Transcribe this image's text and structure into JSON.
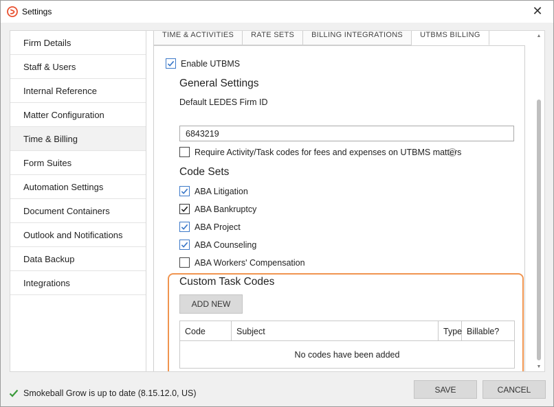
{
  "window": {
    "title": "Settings",
    "close_glyph": "✕"
  },
  "sidebar": {
    "items": [
      {
        "label": "Firm Details"
      },
      {
        "label": "Staff & Users"
      },
      {
        "label": "Internal Reference"
      },
      {
        "label": "Matter Configuration"
      },
      {
        "label": "Time & Billing",
        "active": true
      },
      {
        "label": "Form Suites"
      },
      {
        "label": "Automation Settings"
      },
      {
        "label": "Document Containers"
      },
      {
        "label": "Outlook and Notifications"
      },
      {
        "label": "Data Backup"
      },
      {
        "label": "Integrations"
      }
    ]
  },
  "tabs": [
    {
      "label": "TIME & ACTIVITIES"
    },
    {
      "label": "RATE SETS"
    },
    {
      "label": "BILLING INTEGRATIONS"
    },
    {
      "label": "UTBMS BILLING",
      "active": true
    }
  ],
  "utbms": {
    "enable_label": "Enable UTBMS",
    "enable_checked": true,
    "general_heading": "General Settings",
    "firm_id_label": "Default LEDES Firm ID",
    "firm_id_value": "6843219",
    "require_label": "Require Activity/Task codes for fees and expenses on UTBMS matters",
    "require_checked": false,
    "help_glyph": "?"
  },
  "code_sets": {
    "heading": "Code Sets",
    "items": [
      {
        "label": "ABA Litigation",
        "checked": true
      },
      {
        "label": "ABA Bankruptcy",
        "checked": true
      },
      {
        "label": "ABA Project",
        "checked": true
      },
      {
        "label": "ABA Counseling",
        "checked": true
      },
      {
        "label": "ABA Workers' Compensation",
        "checked": false
      }
    ]
  },
  "custom_codes": {
    "heading": "Custom Task Codes",
    "add_label": "ADD NEW",
    "columns": [
      "Code",
      "Subject",
      "Type",
      "Billable?"
    ],
    "empty_message": "No codes have been added"
  },
  "status": {
    "text": "Smokeball Grow is up to date (8.15.12.0, US)"
  },
  "footer": {
    "save_label": "SAVE",
    "cancel_label": "CANCEL"
  },
  "colors": {
    "accent": "#3b78c8",
    "highlight": "#f0944f",
    "brand": "#e8502f",
    "success": "#3a9a3a"
  }
}
